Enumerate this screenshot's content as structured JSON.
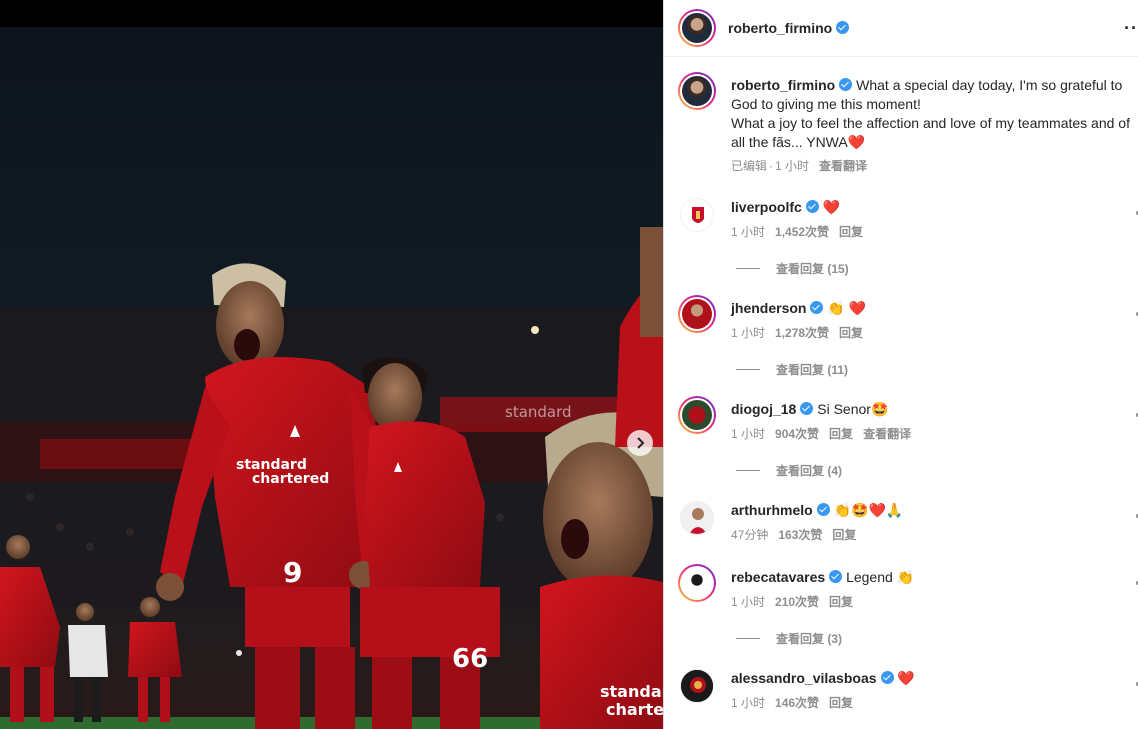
{
  "header": {
    "username": "roberto_firmino",
    "more_icon": "more-icon"
  },
  "caption": {
    "username": "roberto_firmino",
    "line1": "What a special day today, I'm so grateful to God to giving me this moment!",
    "line2": "What a joy to feel the affection and love of my teammates and of all the fãs... YNWA",
    "emoji": "❤️",
    "edited": "已编辑",
    "dot": "·",
    "time": "1 小时",
    "translate": "查看翻译"
  },
  "photo": {
    "next_icon": "chevron-right-icon",
    "jersey_number_main": "9",
    "jersey_number_second": "66",
    "sponsor": "standard chartered",
    "banner": "standard"
  },
  "comments": [
    {
      "username": "liverpoolfc",
      "text": "",
      "emoji": "❤️",
      "time": "1 小时",
      "likes": "1,452次赞",
      "reply": "回复",
      "translate": "",
      "replies": "查看回复 (15)"
    },
    {
      "username": "jhenderson",
      "text": "",
      "emoji": "👏 ❤️",
      "time": "1 小时",
      "likes": "1,278次赞",
      "reply": "回复",
      "translate": "",
      "replies": "查看回复 (11)"
    },
    {
      "username": "diogoj_18",
      "text": "Si Senor",
      "emoji": "🤩",
      "time": "1 小时",
      "likes": "904次赞",
      "reply": "回复",
      "translate": "查看翻译",
      "replies": "查看回复 (4)"
    },
    {
      "username": "arthurhmelo",
      "text": "",
      "emoji": "👏🤩❤️🙏",
      "time": "47分钟",
      "likes": "163次赞",
      "reply": "回复",
      "translate": "",
      "replies": ""
    },
    {
      "username": "rebecatavares",
      "text": "Legend",
      "emoji": "👏",
      "time": "1 小时",
      "likes": "210次赞",
      "reply": "回复",
      "translate": "",
      "replies": "查看回复 (3)"
    },
    {
      "username": "alessandro_vilasboas",
      "text": "",
      "emoji": "❤️",
      "time": "1 小时",
      "likes": "146次赞",
      "reply": "回复",
      "translate": "",
      "replies": ""
    }
  ],
  "colors": {
    "verified": "#3897f0",
    "liverpool_red": "#c8102e",
    "meta_gray": "#8e8e8e"
  }
}
